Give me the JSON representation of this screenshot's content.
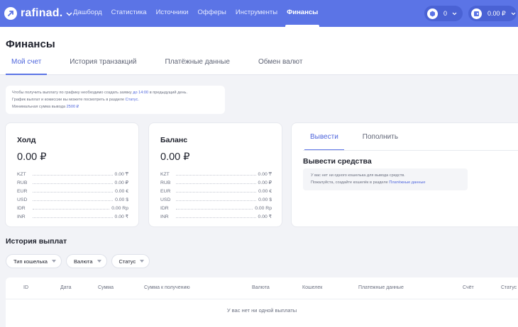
{
  "brand": {
    "name": "rafinad."
  },
  "nav": {
    "items": [
      {
        "label": "Дашборд",
        "active": false
      },
      {
        "label": "Статистика",
        "active": false
      },
      {
        "label": "Источники",
        "active": false
      },
      {
        "label": "Офферы",
        "active": false
      },
      {
        "label": "Инструменты",
        "active": false
      },
      {
        "label": "Финансы",
        "active": true
      }
    ]
  },
  "user": {
    "counter_value": "0",
    "balance_value": "0.00 ₽"
  },
  "page": {
    "title": "Финансы",
    "tabs": [
      {
        "label": "Мой счет",
        "active": true
      },
      {
        "label": "История транзакций",
        "active": false
      },
      {
        "label": "Платёжные данные",
        "active": false
      },
      {
        "label": "Обмен валют",
        "active": false
      }
    ]
  },
  "notice": {
    "line1_pre": "Чтобы получить выплату по графику необходимо создать заявку",
    "line1_link": "до 14:00",
    "line1_post": "в предыдущий день.",
    "line2_pre": "График выплат и комиссии вы можете посмотреть в разделе",
    "line2_link": "Статус.",
    "line3_pre": "Минимальная сумма вывода",
    "line3_value": "2500 ₽"
  },
  "hold": {
    "title": "Холд",
    "amount": "0.00 ₽",
    "rows": [
      {
        "cur": "KZT",
        "amt": "0.00 ₸"
      },
      {
        "cur": "RUB",
        "amt": "0.00 ₽"
      },
      {
        "cur": "EUR",
        "amt": "0.00 €"
      },
      {
        "cur": "USD",
        "amt": "0.00 $"
      },
      {
        "cur": "IDR",
        "amt": "0.00 Rp"
      },
      {
        "cur": "INR",
        "amt": "0.00 ₹"
      }
    ]
  },
  "balance": {
    "title": "Баланс",
    "amount": "0.00 ₽",
    "rows": [
      {
        "cur": "KZT",
        "amt": "0.00 ₸"
      },
      {
        "cur": "RUB",
        "amt": "0.00 ₽"
      },
      {
        "cur": "EUR",
        "amt": "0.00 €"
      },
      {
        "cur": "USD",
        "amt": "0.00 $"
      },
      {
        "cur": "IDR",
        "amt": "0.00 Rp"
      },
      {
        "cur": "INR",
        "amt": "0.00 ₹"
      }
    ]
  },
  "withdraw": {
    "tabs": [
      {
        "label": "Вывести",
        "active": true
      },
      {
        "label": "Пополнить",
        "active": false
      }
    ],
    "title": "Вывести средства",
    "info_line1": "У вас нет ни одного кошелька для вывода средств.",
    "info_line2_pre": "Пожалуйста, создайте кошелёк в разделе",
    "info_line2_link": "Платёжные данные"
  },
  "history": {
    "title": "История выплат",
    "filters": [
      "Тип кошелька",
      "Валюта",
      "Статус"
    ],
    "columns": [
      "ID",
      "Дата",
      "Сумма",
      "Сумма к получению",
      "Валюта",
      "Кошелек",
      "Платежные данные",
      "Счёт",
      "Статус"
    ],
    "empty_text": "У вас нет ни одной выплаты"
  },
  "colors": {
    "accent": "#5b74e6",
    "link": "#4f66dc",
    "background": "#f2f3f7"
  }
}
